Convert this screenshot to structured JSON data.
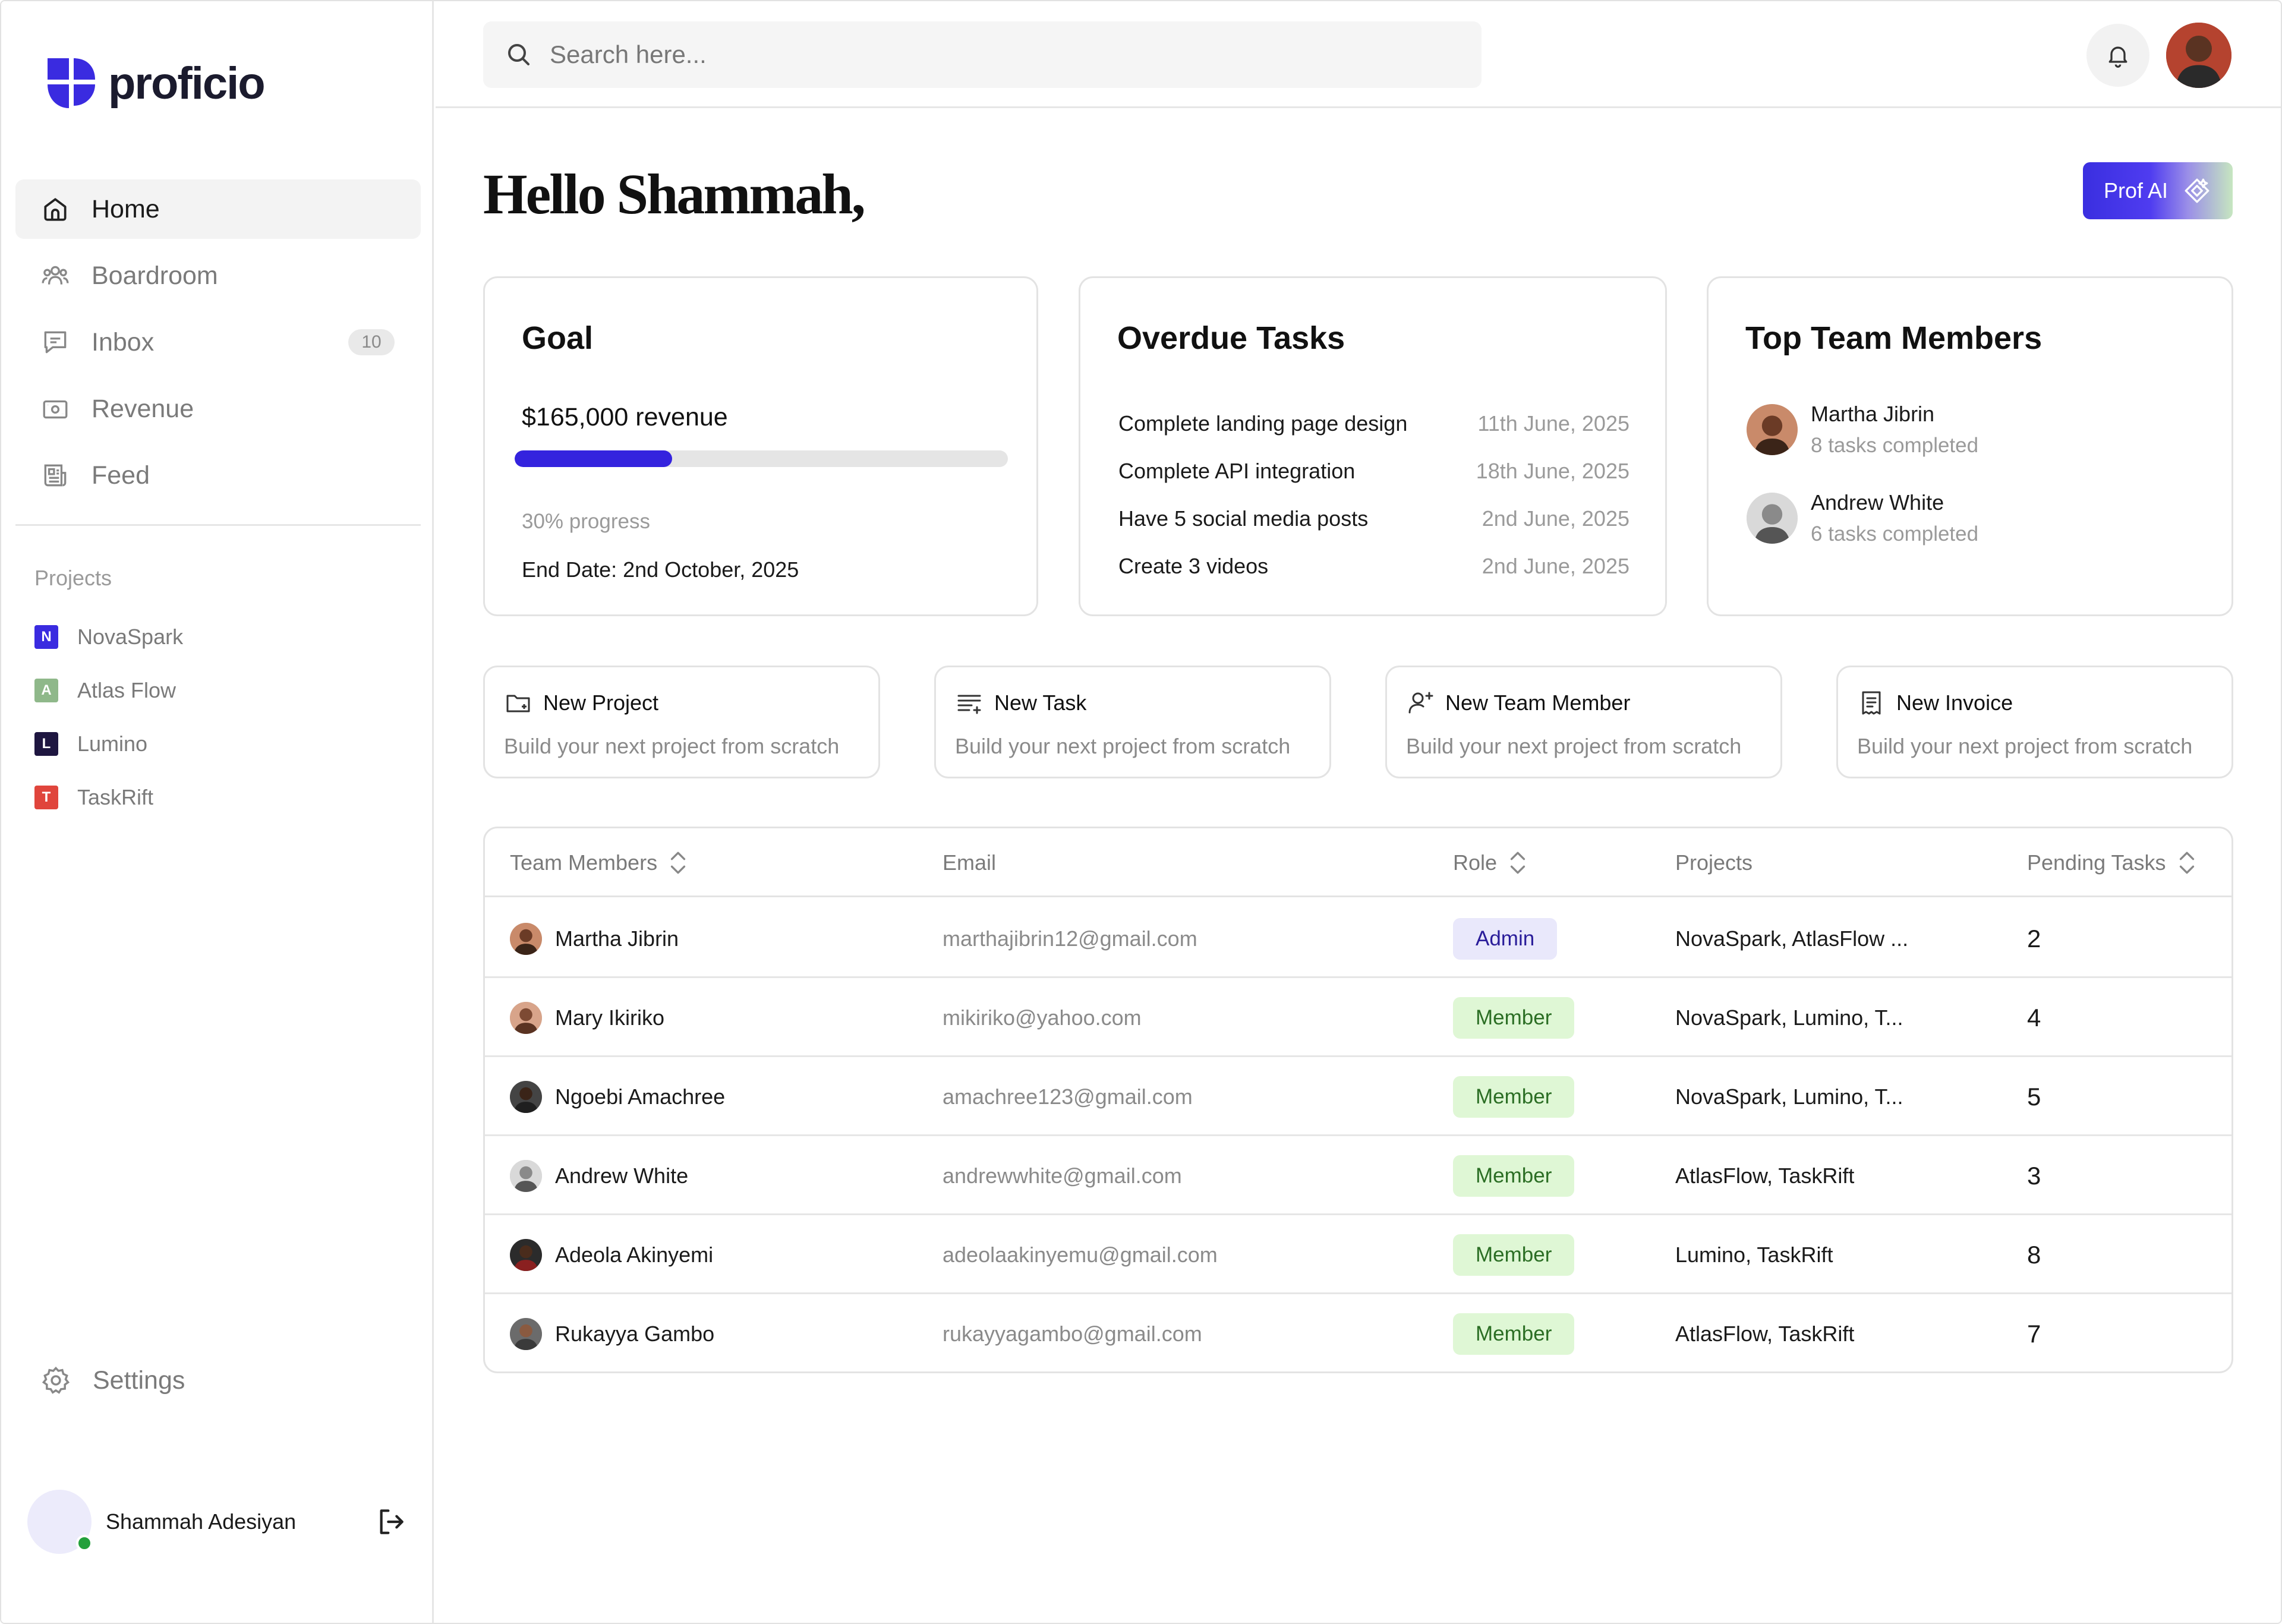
{
  "brand": {
    "name": "proficio",
    "color": "#3423de"
  },
  "sidebar": {
    "nav": [
      {
        "label": "Home",
        "icon": "home-icon",
        "active": true
      },
      {
        "label": "Boardroom",
        "icon": "users-icon"
      },
      {
        "label": "Inbox",
        "icon": "inbox-icon",
        "badge": "10"
      },
      {
        "label": "Revenue",
        "icon": "money-icon"
      },
      {
        "label": "Feed",
        "icon": "news-icon"
      }
    ],
    "projects_title": "Projects",
    "projects": [
      {
        "initial": "N",
        "name": "NovaSpark",
        "color": "#3a2be0"
      },
      {
        "initial": "A",
        "name": "Atlas Flow",
        "color": "#8fb88a"
      },
      {
        "initial": "L",
        "name": "Lumino",
        "color": "#1e1640"
      },
      {
        "initial": "T",
        "name": "TaskRift",
        "color": "#e0453c"
      }
    ],
    "settings_label": "Settings",
    "user_name": "Shammah Adesiyan"
  },
  "header": {
    "search_placeholder": "Search here..."
  },
  "main": {
    "greeting": "Hello Shammah,",
    "prof_ai_label": "Prof AI",
    "goal": {
      "title": "Goal",
      "amount": "$165,000 revenue",
      "progress": 0.3,
      "progress_text": "30% progress",
      "end_date": "End Date: 2nd October, 2025"
    },
    "overdue": {
      "title": "Overdue Tasks",
      "tasks": [
        {
          "name": "Complete landing page design",
          "date": "11th June, 2025"
        },
        {
          "name": "Complete API integration",
          "date": "18th June, 2025"
        },
        {
          "name": "Have 5 social media posts",
          "date": "2nd June, 2025"
        },
        {
          "name": "Create 3 videos",
          "date": "2nd June, 2025"
        }
      ]
    },
    "top_team": {
      "title": "Top Team Members",
      "members": [
        {
          "name": "Martha Jibrin",
          "sub": "8 tasks completed"
        },
        {
          "name": "Andrew White",
          "sub": "6 tasks completed"
        }
      ]
    },
    "actions": [
      {
        "title": "New Project",
        "sub": "Build your next project from scratch",
        "icon": "folder-plus-icon"
      },
      {
        "title": "New Task",
        "sub": "Build your next project from scratch",
        "icon": "list-plus-icon"
      },
      {
        "title": "New Team Member",
        "sub": "Build your next project from scratch",
        "icon": "user-plus-icon"
      },
      {
        "title": "New Invoice",
        "sub": "Build your next project from scratch",
        "icon": "invoice-icon"
      }
    ],
    "table": {
      "headers": {
        "members": "Team Members",
        "email": "Email",
        "role": "Role",
        "projects": "Projects",
        "pending": "Pending Tasks"
      },
      "rows": [
        {
          "name": "Martha Jibrin",
          "email": "marthajibrin12@gmail.com",
          "role": "Admin",
          "projects": "NovaSpark, AtlasFlow ...",
          "pending": "2"
        },
        {
          "name": "Mary Ikiriko",
          "email": "mikiriko@yahoo.com",
          "role": "Member",
          "projects": "NovaSpark, Lumino, T...",
          "pending": "4"
        },
        {
          "name": "Ngoebi Amachree",
          "email": "amachree123@gmail.com",
          "role": "Member",
          "projects": "NovaSpark, Lumino, T...",
          "pending": "5"
        },
        {
          "name": "Andrew White",
          "email": "andrewwhite@gmail.com",
          "role": "Member",
          "projects": "AtlasFlow, TaskRift",
          "pending": "3"
        },
        {
          "name": "Adeola Akinyemi",
          "email": "adeolaakinyemu@gmail.com",
          "role": "Member",
          "projects": "Lumino, TaskRift",
          "pending": "8"
        },
        {
          "name": "Rukayya Gambo",
          "email": "rukayyagambo@gmail.com",
          "role": "Member",
          "projects": "AtlasFlow, TaskRift",
          "pending": "7"
        }
      ]
    }
  }
}
